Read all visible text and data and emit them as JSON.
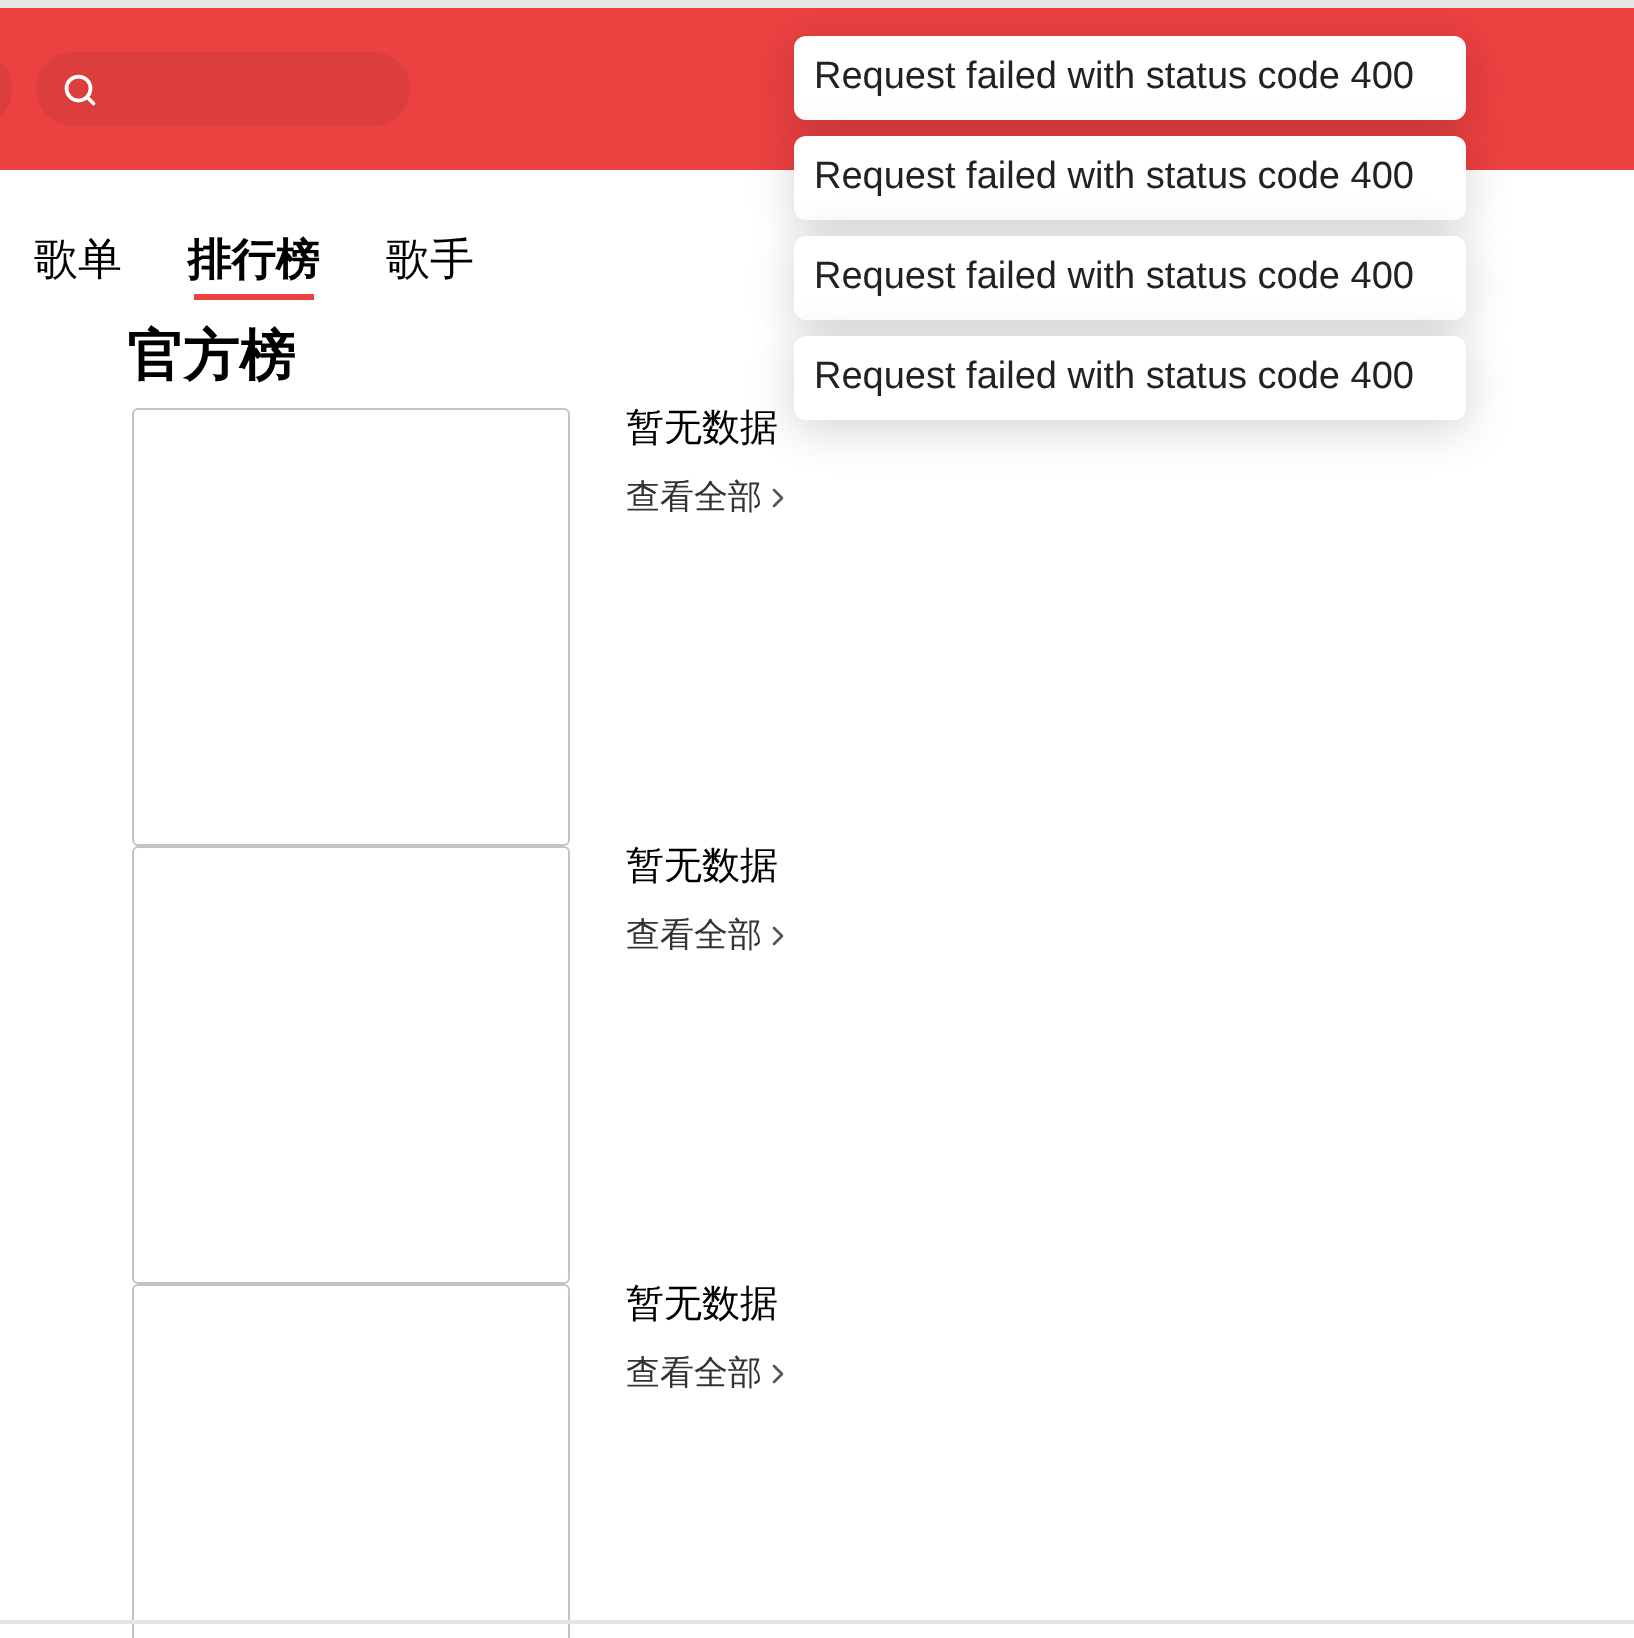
{
  "tabs": [
    {
      "label": "歌单",
      "selected": false
    },
    {
      "label": "排行榜",
      "selected": true
    },
    {
      "label": "歌手",
      "selected": false
    }
  ],
  "section_title": "官方榜",
  "charts": [
    {
      "empty_text": "暂无数据",
      "link": "查看全部"
    },
    {
      "empty_text": "暂无数据",
      "link": "查看全部"
    },
    {
      "empty_text": "暂无数据",
      "link": "查看全部"
    }
  ],
  "toasts": [
    "Request failed with status code 400",
    "Request failed with status code 400",
    "Request failed with status code 400",
    "Request failed with status code 400"
  ]
}
